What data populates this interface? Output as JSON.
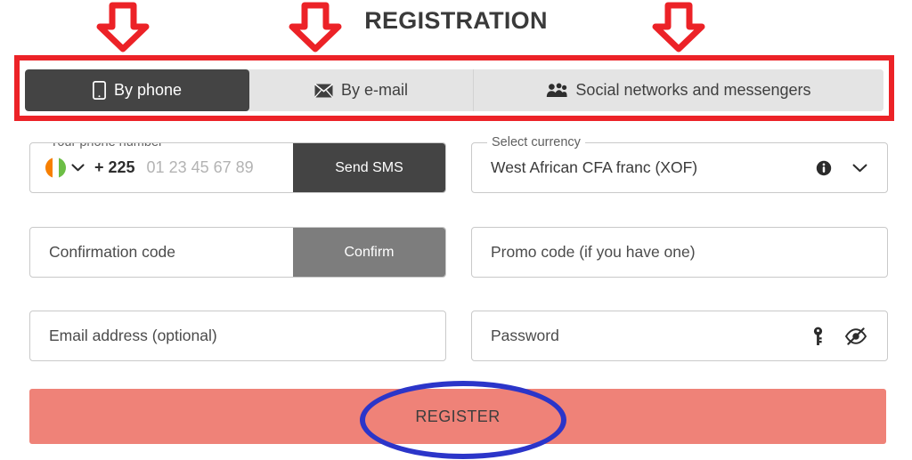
{
  "page": {
    "title": "REGISTRATION",
    "background_color": "#ffffff"
  },
  "annotations": {
    "highlight_color": "#ec2227",
    "circle_color": "#2b35c9",
    "arrow_count": 3,
    "arrow_icon": "arrow-down-icon",
    "rectangle_target": "registration-method-tabs",
    "ellipse_target": "register-button"
  },
  "tabs": [
    {
      "label": "By phone",
      "icon": "mobile-phone-icon",
      "active": true
    },
    {
      "label": "By e-mail",
      "icon": "envelope-icon",
      "active": false
    },
    {
      "label": "Social networks and messengers",
      "icon": "users-group-icon",
      "active": false
    }
  ],
  "form": {
    "phone": {
      "legend": "Your phone number",
      "country_flag": "cote-divoire-flag-icon",
      "dial_code": "+ 225",
      "placeholder": "01 23 45 67 89",
      "value": "",
      "button_label": "Send SMS"
    },
    "currency": {
      "legend": "Select currency",
      "value": "West African CFA franc (XOF)",
      "info_icon": "info-circle-icon",
      "chevron_icon": "chevron-down-icon"
    },
    "confirmation_code": {
      "placeholder": "Confirmation code",
      "value": "",
      "button_label": "Confirm",
      "button_disabled": true
    },
    "promo_code": {
      "placeholder": "Promo code (if you have one)",
      "value": ""
    },
    "email": {
      "placeholder": "Email address (optional)",
      "value": ""
    },
    "password": {
      "placeholder": "Password",
      "value": "",
      "generate_icon": "key-icon",
      "visibility_icon": "eye-slash-icon"
    }
  },
  "submit": {
    "label": "REGISTER",
    "color": "#ef8278"
  }
}
